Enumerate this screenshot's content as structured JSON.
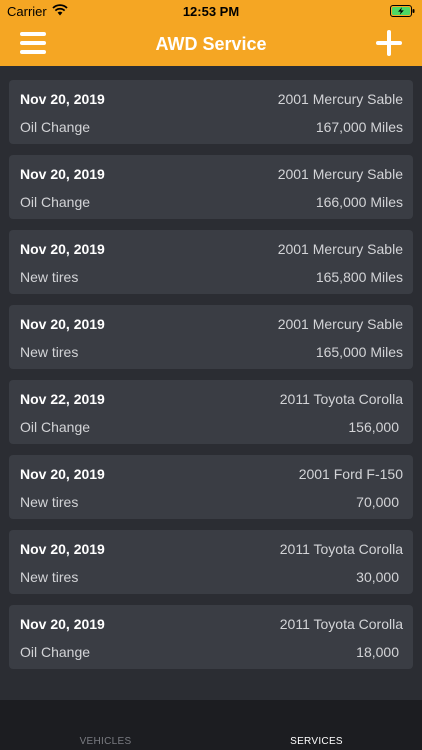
{
  "status_bar": {
    "carrier": "Carrier",
    "time": "12:53 PM"
  },
  "header": {
    "title": "AWD Service",
    "menu_icon": "hamburger-menu-icon",
    "add_icon": "plus-icon"
  },
  "colors": {
    "accent": "#f5a623",
    "background": "#2b2d33",
    "card": "#3a3d44",
    "tabbar": "#1c1d21"
  },
  "services": [
    {
      "date": "Nov 20, 2019",
      "vehicle": "2001 Mercury Sable",
      "service": "Oil Change",
      "mileage": "167,000 Miles"
    },
    {
      "date": "Nov 20, 2019",
      "vehicle": "2001 Mercury Sable",
      "service": "Oil Change",
      "mileage": "166,000 Miles"
    },
    {
      "date": "Nov 20, 2019",
      "vehicle": "2001 Mercury Sable",
      "service": "New tires",
      "mileage": "165,800 Miles"
    },
    {
      "date": "Nov 20, 2019",
      "vehicle": "2001 Mercury Sable",
      "service": "New tires",
      "mileage": "165,000 Miles"
    },
    {
      "date": "Nov 22, 2019",
      "vehicle": "2011 Toyota Corolla",
      "service": "Oil Change",
      "mileage": "156,000"
    },
    {
      "date": "Nov 20, 2019",
      "vehicle": "2001 Ford F-150",
      "service": "New tires",
      "mileage": "70,000"
    },
    {
      "date": "Nov 20, 2019",
      "vehicle": "2011 Toyota Corolla",
      "service": "New tires",
      "mileage": "30,000"
    },
    {
      "date": "Nov 20, 2019",
      "vehicle": "2011 Toyota Corolla",
      "service": "Oil Change",
      "mileage": "18,000"
    }
  ],
  "tabs": {
    "vehicles": "VEHICLES",
    "services": "SERVICES"
  }
}
